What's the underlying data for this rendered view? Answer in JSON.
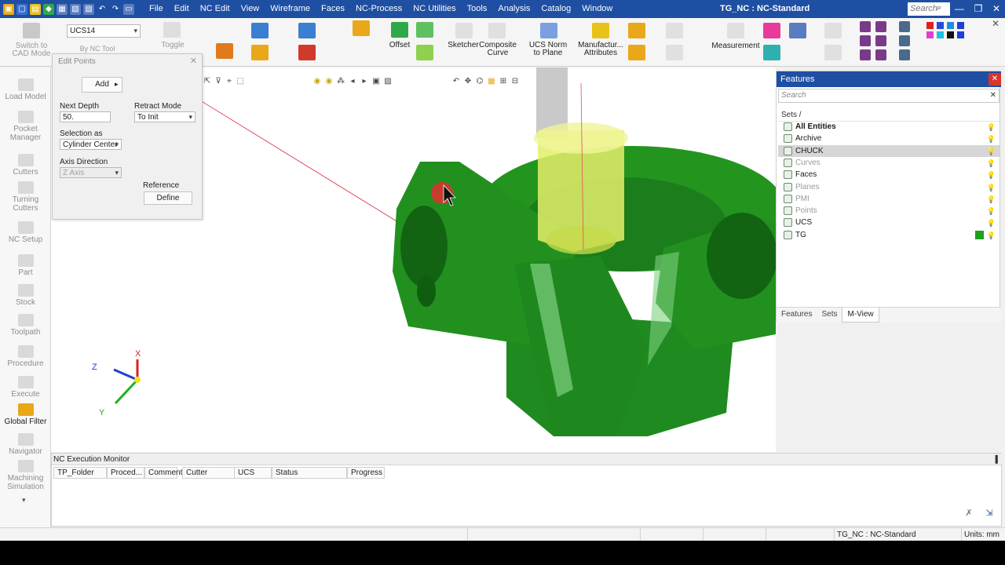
{
  "titlebar": {
    "app_title": "TG_NC : NC-Standard",
    "search_placeholder": "Search",
    "menus": [
      "File",
      "Edit",
      "NC Edit",
      "View",
      "Wireframe",
      "Faces",
      "NC-Process",
      "NC Utilities",
      "Tools",
      "Analysis",
      "Catalog",
      "Window"
    ],
    "window_buttons": [
      "—",
      "❐",
      "✕"
    ]
  },
  "ribbon": {
    "switch_cad": "Switch to\nCAD Mode",
    "ucs_value": "UCS14",
    "by_nc_tool": "By NC Tool",
    "toggle": "Toggle",
    "offset": "Offset",
    "sketcher": "Sketcher",
    "composite_curve": "Composite\nCurve",
    "ucs_norm_plane": "UCS Norm\nto Plane",
    "manufacturing_attributes": "Manufactur...\nAttributes",
    "measurement": "Measurement",
    "palette_colors": [
      "#e41e1e",
      "#1f4ed8",
      "#1e8fe0",
      "#1f3fd8",
      "#e040d0",
      "#20c0e0",
      "#111111",
      "#1f3fd8"
    ]
  },
  "sidebar": {
    "items": [
      "Load Model",
      "Pocket\nManager",
      "Cutters",
      "Turning\nCutters",
      "NC Setup",
      "Part",
      "Stock",
      "Toolpath",
      "Procedure",
      "Execute",
      "Global Filter",
      "Navigator",
      "Machining\nSimulation"
    ]
  },
  "edit_points": {
    "title": "Edit Points",
    "add_label": "Add",
    "next_depth_label": "Next Depth",
    "next_depth_value": "50.",
    "retract_mode_label": "Retract Mode",
    "retract_mode_value": "To Init",
    "selection_as_label": "Selection as",
    "selection_as_value": "Cylinder Center",
    "axis_direction_label": "Axis Direction",
    "axis_direction_value": "Z Axis",
    "reference_label": "Reference",
    "define_label": "Define"
  },
  "features": {
    "title": "Features",
    "search_placeholder": "Search",
    "sets_header": "Sets /",
    "sets": [
      {
        "label": "All Entities",
        "bold": true
      },
      {
        "label": "Archive"
      },
      {
        "label": "CHUCK",
        "selected": true
      },
      {
        "label": "Curves",
        "dim": true
      },
      {
        "label": "Faces"
      },
      {
        "label": "Planes",
        "dim": true
      },
      {
        "label": "PMI",
        "dim": true
      },
      {
        "label": "Points",
        "dim": true
      },
      {
        "label": "UCS"
      },
      {
        "label": "TG",
        "swatch": "#1fa01f"
      }
    ],
    "tabs": [
      "Features",
      "Sets",
      "M-View"
    ]
  },
  "nc_monitor": {
    "title": "NC Execution Monitor",
    "columns": [
      "TP_Folder",
      "Proced...",
      "Comment",
      "Cutter",
      "UCS",
      "Status",
      "Progress"
    ]
  },
  "axes": {
    "x": "X",
    "y": "Y",
    "z": "Z"
  },
  "statusbar": {
    "file": "TG_NC : NC-Standard",
    "units": "Units: mm"
  },
  "colors": {
    "part_green": "#1f8a1f",
    "part_green_dark": "#0f5e0f",
    "tool_yellow": "#d8e84a",
    "title_blue": "#1e4fa3"
  }
}
